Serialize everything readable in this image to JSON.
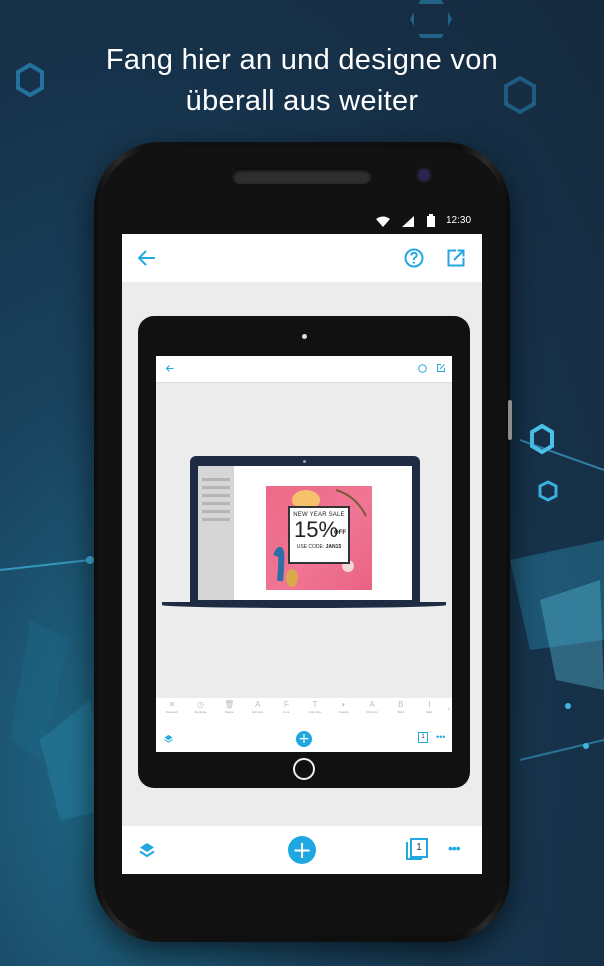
{
  "headline": {
    "line1": "Fang hier an und designe von",
    "line2": "überall aus weiter"
  },
  "status_bar": {
    "time": "12:30",
    "icons": [
      "wifi-icon",
      "signal-icon",
      "battery-icon"
    ]
  },
  "app_bar": {
    "back_icon": "arrow-left-icon",
    "help_icon": "help-circle-icon",
    "share_icon": "open-external-icon"
  },
  "bottom_bar": {
    "layers_icon": "layers-icon",
    "add_label": "+",
    "page_count": "1",
    "more_icon": "more-horizontal-icon"
  },
  "tablet": {
    "toolbar": [
      {
        "icon": "✕",
        "label": "Deselect"
      },
      {
        "icon": "◷",
        "label": "Duplicate"
      },
      {
        "icon": "🗑",
        "label": "Delete"
      },
      {
        "icon": "A",
        "label": "Edit text"
      },
      {
        "icon": "F",
        "label": "Font"
      },
      {
        "icon": "T",
        "label": "Font size"
      },
      {
        "icon": "◗",
        "label": "Opacity"
      },
      {
        "icon": "A",
        "label": "Fill color"
      },
      {
        "icon": "B",
        "label": "Bold"
      },
      {
        "icon": "I",
        "label": "Italic"
      }
    ],
    "page_count": "1"
  },
  "promo": {
    "line1": "NEW YEAR SALE",
    "percent": "15%",
    "off": "OFF",
    "code_label": "USE CODE:",
    "code": "JAN15"
  },
  "colors": {
    "accent": "#1ea7e1",
    "background": "#16324a",
    "promo_pink": "#ef6d8d"
  }
}
